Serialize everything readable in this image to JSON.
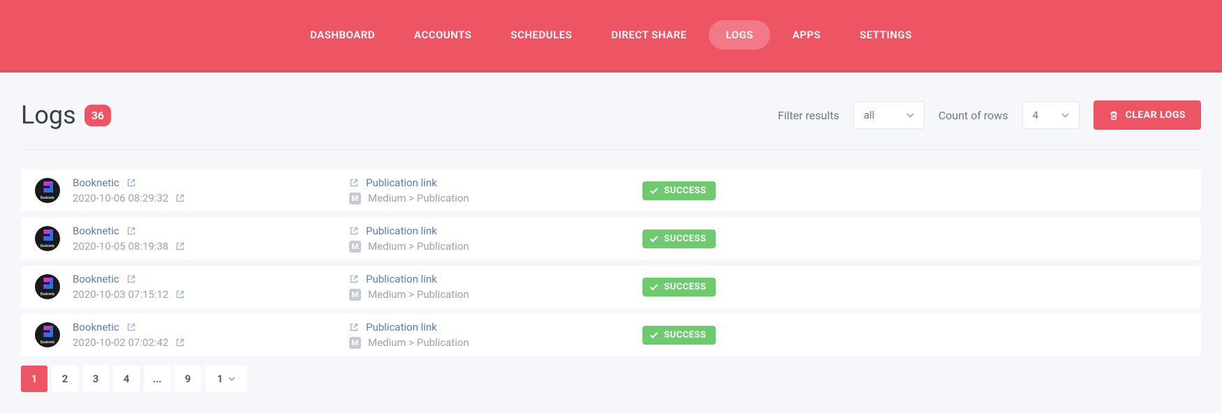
{
  "nav": {
    "items": [
      {
        "label": "DASHBOARD"
      },
      {
        "label": "ACCOUNTS"
      },
      {
        "label": "SCHEDULES"
      },
      {
        "label": "DIRECT SHARE"
      },
      {
        "label": "LOGS"
      },
      {
        "label": "APPS"
      },
      {
        "label": "SETTINGS"
      }
    ],
    "active_index": 4
  },
  "page": {
    "title": "Logs",
    "count": "36"
  },
  "filters": {
    "filter_label": "Filter results",
    "filter_value": "all",
    "rows_label": "Count of rows",
    "rows_value": "4",
    "clear_label": "CLEAR LOGS"
  },
  "logs": [
    {
      "account": "Booknetic",
      "timestamp": "2020-10-06 08:29:32",
      "link": "Publication link",
      "channel": "Medium > Publication",
      "channel_badge": "M",
      "status": "SUCCESS"
    },
    {
      "account": "Booknetic",
      "timestamp": "2020-10-05 08:19:38",
      "link": "Publication link",
      "channel": "Medium > Publication",
      "channel_badge": "M",
      "status": "SUCCESS"
    },
    {
      "account": "Booknetic",
      "timestamp": "2020-10-03 07:15:12",
      "link": "Publication link",
      "channel": "Medium > Publication",
      "channel_badge": "M",
      "status": "SUCCESS"
    },
    {
      "account": "Booknetic",
      "timestamp": "2020-10-02 07:02:42",
      "link": "Publication link",
      "channel": "Medium > Publication",
      "channel_badge": "M",
      "status": "SUCCESS"
    }
  ],
  "pagination": {
    "pages": [
      "1",
      "2",
      "3",
      "4",
      "...",
      "9"
    ],
    "active_index": 0,
    "jump": "1"
  }
}
